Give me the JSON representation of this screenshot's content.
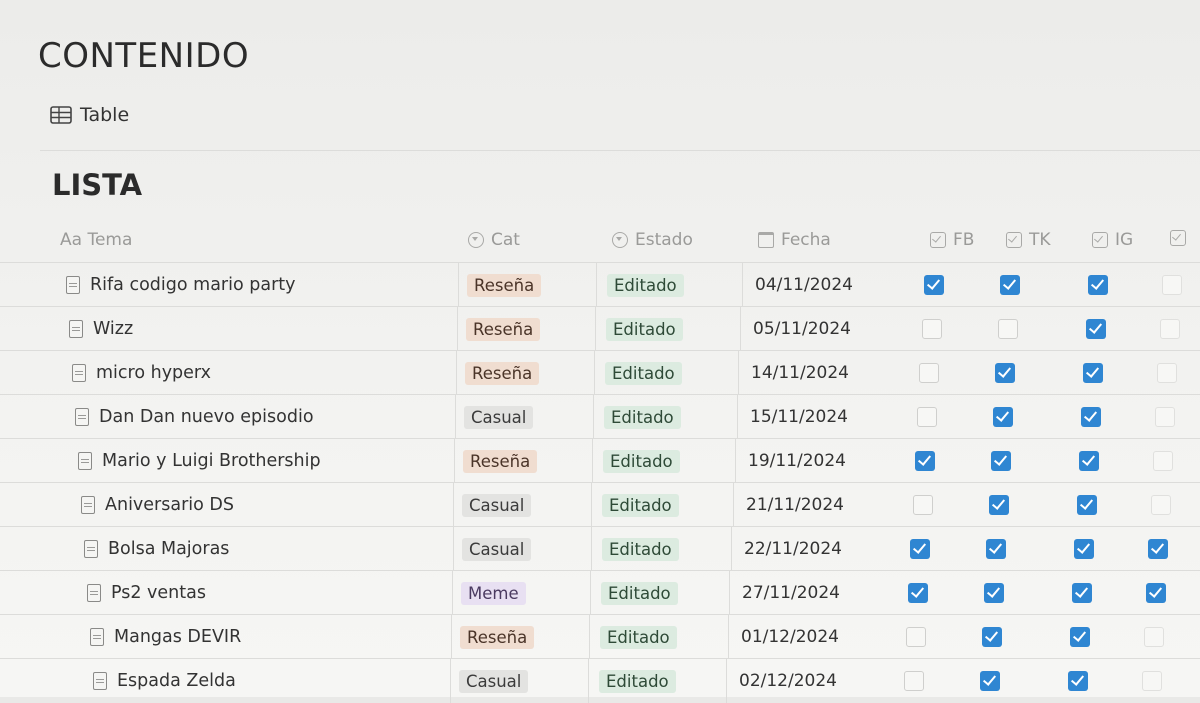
{
  "page": {
    "title": "CONTENIDO",
    "view_tab": "Table"
  },
  "database": {
    "title": "LISTA",
    "columns": {
      "tema": "Aa Tema",
      "cat": "Cat",
      "estado": "Estado",
      "fecha": "Fecha",
      "fb": "FB",
      "tk": "TK",
      "ig": "IG"
    },
    "rows": [
      {
        "tema": "Rifa codigo mario party",
        "cat": "Reseña",
        "estado": "Editado",
        "fecha": "04/11/2024",
        "fb": true,
        "tk": true,
        "ig": true,
        "extra": false
      },
      {
        "tema": "Wizz",
        "cat": "Reseña",
        "estado": "Editado",
        "fecha": "05/11/2024",
        "fb": false,
        "tk": false,
        "ig": true,
        "extra": false
      },
      {
        "tema": "micro hyperx",
        "cat": "Reseña",
        "estado": "Editado",
        "fecha": "14/11/2024",
        "fb": false,
        "tk": true,
        "ig": true,
        "extra": false
      },
      {
        "tema": "Dan Dan nuevo episodio",
        "cat": "Casual",
        "estado": "Editado",
        "fecha": "15/11/2024",
        "fb": false,
        "tk": true,
        "ig": true,
        "extra": false
      },
      {
        "tema": "Mario y Luigi Brothership",
        "cat": "Reseña",
        "estado": "Editado",
        "fecha": "19/11/2024",
        "fb": true,
        "tk": true,
        "ig": true,
        "extra": false
      },
      {
        "tema": "Aniversario DS",
        "cat": "Casual",
        "estado": "Editado",
        "fecha": "21/11/2024",
        "fb": false,
        "tk": true,
        "ig": true,
        "extra": false
      },
      {
        "tema": "Bolsa Majoras",
        "cat": "Casual",
        "estado": "Editado",
        "fecha": "22/11/2024",
        "fb": true,
        "tk": true,
        "ig": true,
        "extra": true
      },
      {
        "tema": "Ps2 ventas",
        "cat": "Meme",
        "estado": "Editado",
        "fecha": "27/11/2024",
        "fb": true,
        "tk": true,
        "ig": true,
        "extra": true
      },
      {
        "tema": "Mangas DEVIR",
        "cat": "Reseña",
        "estado": "Editado",
        "fecha": "01/12/2024",
        "fb": false,
        "tk": true,
        "ig": true,
        "extra": false
      },
      {
        "tema": "Espada Zelda",
        "cat": "Casual",
        "estado": "Editado",
        "fecha": "02/12/2024",
        "fb": false,
        "tk": true,
        "ig": true,
        "extra": false
      }
    ]
  },
  "colors": {
    "checkbox_on": "#2f86d2",
    "tag_resena": "#f0ddd0",
    "tag_casual": "#e3e3e1",
    "tag_meme": "#e8e0f2",
    "tag_estado": "#dcebe0"
  }
}
